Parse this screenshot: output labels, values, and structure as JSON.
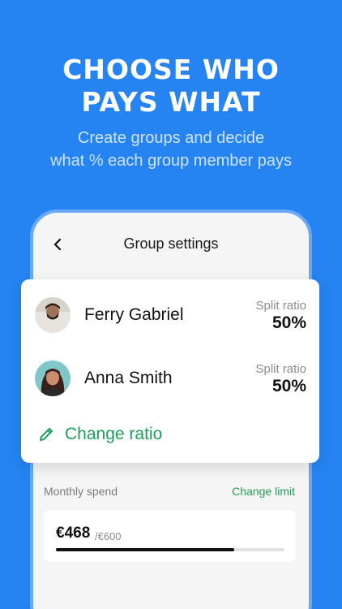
{
  "hero": {
    "title_line1": "CHOOSE WHO",
    "title_line2": "PAYS WHAT",
    "subtitle_line1": "Create groups and decide",
    "subtitle_line2": "what % each group member pays"
  },
  "screen": {
    "title": "Group settings",
    "back_icon": "chevron-left-icon"
  },
  "members": [
    {
      "name": "Ferry Gabriel",
      "ratio_label": "Split ratio",
      "ratio_value": "50%",
      "avatar": "avatar-photo"
    },
    {
      "name": "Anna Smith",
      "ratio_label": "Split ratio",
      "ratio_value": "50%",
      "avatar": "avatar-photo"
    }
  ],
  "change_ratio": {
    "label": "Change ratio",
    "icon": "pencil-icon"
  },
  "spend": {
    "label": "Monthly spend",
    "change_limit_label": "Change limit",
    "amount": "€468",
    "limit": "/€600",
    "progress": 0.78
  },
  "colors": {
    "background": "#2584f2",
    "accent_green": "#1f9d5a",
    "phone_border": "#6aa9f5"
  }
}
